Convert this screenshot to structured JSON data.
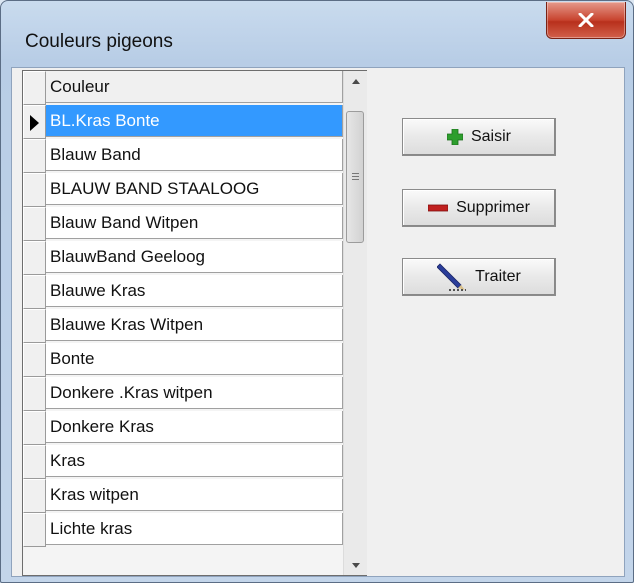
{
  "window": {
    "title": "Couleurs pigeons"
  },
  "grid": {
    "header": "Couleur",
    "selected_index": 0,
    "rows": [
      "BL.Kras Bonte",
      "Blauw Band",
      "BLAUW BAND STAALOOG",
      "Blauw Band Witpen",
      "BlauwBand Geeloog",
      "Blauwe Kras",
      "Blauwe Kras Witpen",
      "Bonte",
      "Donkere .Kras witpen",
      "Donkere Kras",
      "Kras",
      "Kras witpen",
      "Lichte kras"
    ]
  },
  "buttons": {
    "saisir": "Saisir",
    "supprimer": "Supprimer",
    "traiter": "Traiter"
  },
  "icons": {
    "close": "close-icon",
    "add": "plus-icon",
    "delete": "minus-icon",
    "process": "pen-icon",
    "row_pointer": "row-pointer-icon",
    "scroll_up": "scroll-up-icon",
    "scroll_down": "scroll-down-icon"
  },
  "colors": {
    "selection": "#3399ff",
    "add_icon": "#2e9e2e",
    "delete_icon": "#c0201f",
    "close_button": "#c8442f"
  }
}
